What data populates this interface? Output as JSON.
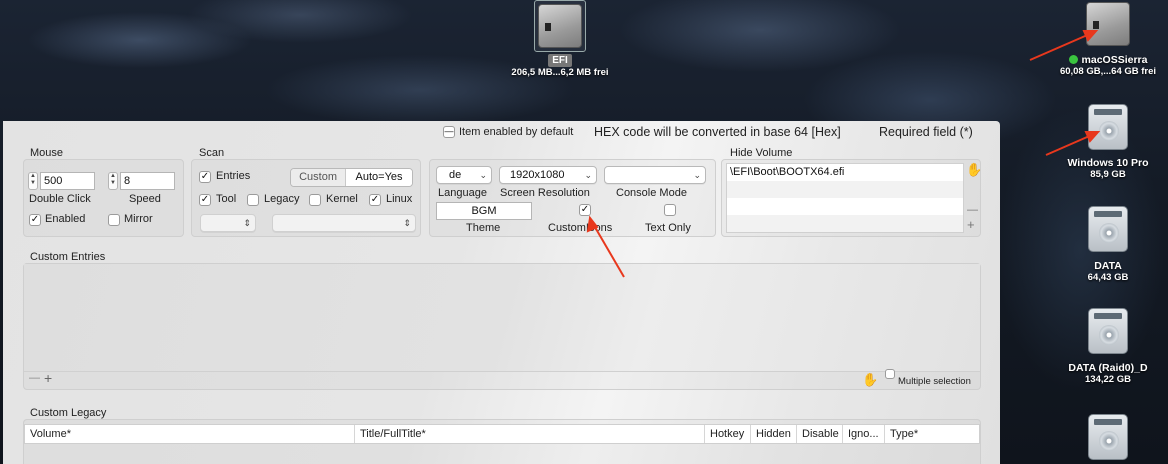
{
  "desktop": {
    "efi_disk": {
      "badge": "EFI",
      "info": "206,5 MB...6,2 MB frei"
    },
    "disks": [
      {
        "name": "macOSSierra",
        "info": "60,08 GB,...64 GB frei",
        "status_color": "#3ac43f"
      },
      {
        "name": "Windows 10 Pro",
        "info": "85,9 GB"
      },
      {
        "name": "DATA",
        "info": "64,43 GB"
      },
      {
        "name": "DATA (Raid0)_D",
        "info": "134,22 GB"
      }
    ]
  },
  "header": {
    "item_enabled_legend": "Item enabled by default",
    "hex_note": "HEX code will be converted in base 64 [Hex]",
    "required_note": "Required field (*)"
  },
  "mouse": {
    "title": "Mouse",
    "double_click_value": "500",
    "double_click_label": "Double Click",
    "speed_value": "8",
    "speed_label": "Speed",
    "enabled_label": "Enabled",
    "enabled_checked": "✓",
    "mirror_label": "Mirror"
  },
  "scan": {
    "title": "Scan",
    "entries_label": "Entries",
    "entries_checked": "✓",
    "segment_custom": "Custom",
    "segment_auto": "Auto=Yes",
    "tool_label": "Tool",
    "tool_checked": "✓",
    "legacy_label": "Legacy",
    "kernel_label": "Kernel",
    "linux_label": "Linux",
    "linux_checked": "✓"
  },
  "gui": {
    "language_value": "de",
    "language_label": "Language",
    "resolution_value": "1920x1080",
    "resolution_label": "Screen Resolution",
    "console_mode_value": "",
    "console_mode_label": "Console Mode",
    "theme_value": "BGM",
    "theme_label": "Theme",
    "custom_icons_label": "CustomIcons",
    "custom_icons_checked": "✓",
    "text_only_label": "Text Only"
  },
  "hide_volume": {
    "title": "Hide Volume",
    "rows": [
      "\\EFI\\Boot\\BOOTX64.efi",
      "",
      "",
      ""
    ],
    "remove_label": "—",
    "add_label": "+"
  },
  "custom_entries": {
    "title": "Custom Entries",
    "remove_label": "—",
    "add_label": "+",
    "multiple_selection_label": "Multiple selection"
  },
  "custom_legacy": {
    "title": "Custom Legacy",
    "columns": [
      "Volume*",
      "Title/FullTitle*",
      "Hotkey",
      "Hidden",
      "Disable",
      "Igno...",
      "Type*"
    ]
  },
  "annotation_color": "#e8381d"
}
